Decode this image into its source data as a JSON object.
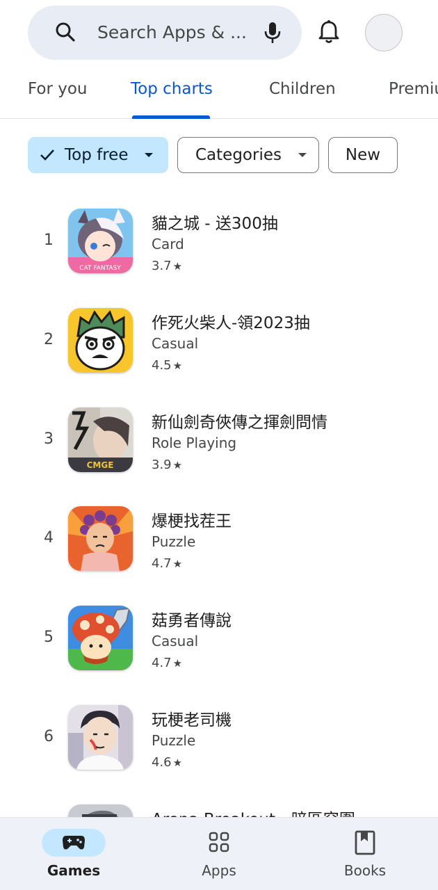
{
  "search": {
    "placeholder": "Search Apps & ..."
  },
  "tabs": [
    {
      "label": "For you"
    },
    {
      "label": "Top charts"
    },
    {
      "label": "Children"
    },
    {
      "label": "Premiu"
    }
  ],
  "chips": {
    "top_free": "Top free",
    "categories": "Categories",
    "new": "New"
  },
  "apps": [
    {
      "rank": "1",
      "title": "貓之城 - 送300抽",
      "category": "Card",
      "rating": "3.7",
      "icon": "cat-city-icon"
    },
    {
      "rank": "2",
      "title": "作死火柴人-領2023抽",
      "category": "Casual",
      "rating": "4.5",
      "icon": "stickman-icon"
    },
    {
      "rank": "3",
      "title": "新仙劍奇俠傳之揮劍問情",
      "category": "Role Playing",
      "rating": "3.9",
      "icon": "sword-fairy-icon"
    },
    {
      "rank": "4",
      "title": "爆梗找茬王",
      "category": "Puzzle",
      "rating": "4.7",
      "icon": "meme-spot-icon"
    },
    {
      "rank": "5",
      "title": "菇勇者傳說",
      "category": "Casual",
      "rating": "4.7",
      "icon": "mushroom-hero-icon"
    },
    {
      "rank": "6",
      "title": "玩梗老司機",
      "category": "Puzzle",
      "rating": "4.6",
      "icon": "meme-driver-icon"
    },
    {
      "rank": "",
      "title": "Arena Breakout - 暗區突圍",
      "category": "",
      "rating": "",
      "icon": "arena-breakout-icon"
    }
  ],
  "bottom_nav": [
    {
      "label": "Games",
      "icon": "gamepad-icon"
    },
    {
      "label": "Apps",
      "icon": "apps-grid-icon"
    },
    {
      "label": "Books",
      "icon": "bookmark-book-icon"
    }
  ],
  "colors": {
    "accent": "#0b57d0",
    "chip_selected": "#c2e7ff",
    "nav_bg": "#eef2f8"
  }
}
